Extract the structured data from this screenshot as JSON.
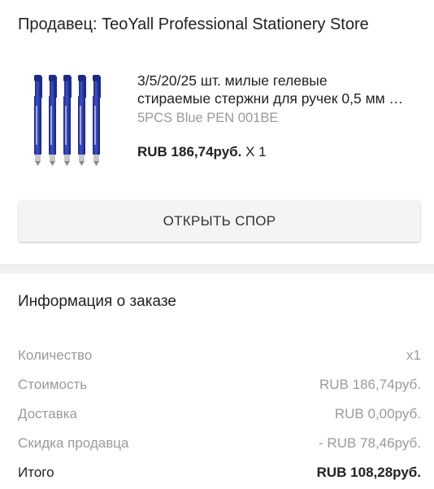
{
  "seller": {
    "text": "Продавец: TeoYall Professional Stationery Store"
  },
  "product": {
    "title_line1": "3/5/20/25 шт. милые гелевые",
    "title_line2": "стираемые стержни для ручек 0,5 мм …",
    "variant": "5PCS Blue PEN 001BE",
    "price": "RUB 186,74руб.",
    "quantity": "X 1"
  },
  "dispute_button": {
    "label": "ОТКРЫТЬ СПОР"
  },
  "order_info": {
    "title": "Информация о заказе",
    "rows": [
      {
        "label": "Количество",
        "value": "x1"
      },
      {
        "label": "Стоимость",
        "value": "RUB 186,74руб."
      },
      {
        "label": "Доставка",
        "value": "RUB 0,00руб."
      },
      {
        "label": "Скидка продавца",
        "value": "- RUB 78,46руб."
      },
      {
        "label": "Итого",
        "value": "RUB 108,28руб."
      }
    ]
  },
  "colors": {
    "pen_blue": "#2a3aa8",
    "muted_text": "#9a9a9a",
    "button_bg": "#f4f4f4"
  }
}
